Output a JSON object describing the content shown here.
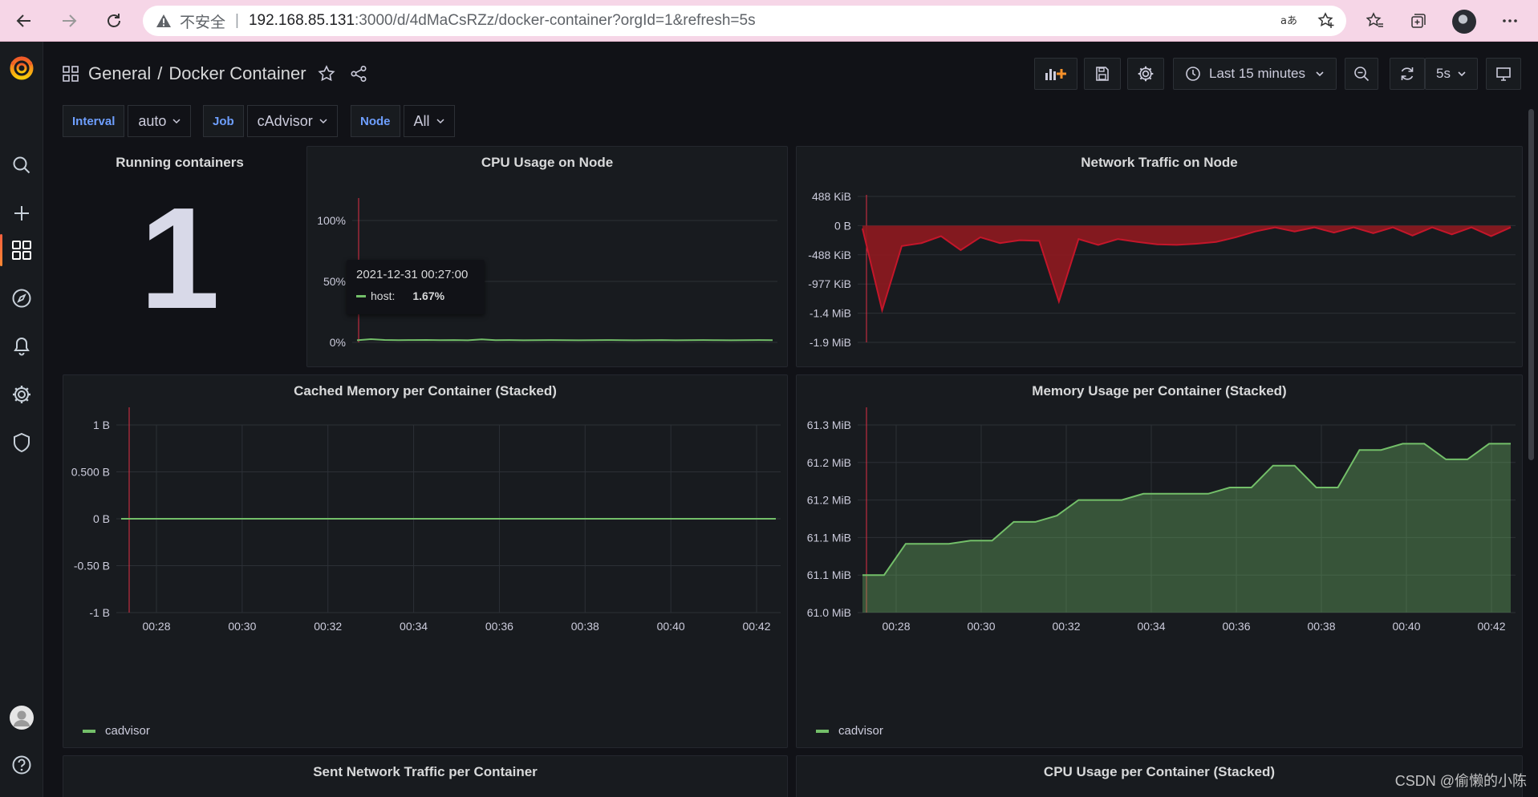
{
  "browser": {
    "insecure_label": "不安全",
    "url_host": "192.168.85.131",
    "url_path": ":3000/d/4dMaCsRZz/docker-container?orgId=1&refresh=5s"
  },
  "header": {
    "folder": "General",
    "separator": "/",
    "title": "Docker Container"
  },
  "toolbar": {
    "time_range": "Last 15 minutes",
    "refresh_interval": "5s"
  },
  "variables": [
    {
      "label": "Interval",
      "value": "auto"
    },
    {
      "label": "Job",
      "value": "cAdvisor"
    },
    {
      "label": "Node",
      "value": "All"
    }
  ],
  "panels": {
    "running": {
      "title": "Running containers",
      "value": "1"
    },
    "cpu_node": {
      "title": "CPU Usage on Node",
      "tooltip": {
        "time": "2021-12-31 00:27:00",
        "series": "host:",
        "value": "1.67%"
      }
    },
    "net_node": {
      "title": "Network Traffic on Node"
    },
    "cached_mem": {
      "title": "Cached Memory per Container (Stacked)",
      "legend": "cadvisor"
    },
    "mem_usage": {
      "title": "Memory Usage per Container (Stacked)",
      "legend": "cadvisor"
    },
    "sent_net": {
      "title": "Sent Network Traffic per Container"
    },
    "cpu_container": {
      "title": "CPU Usage per Container (Stacked)"
    }
  },
  "watermark": "CSDN @偷懒的小陈",
  "colors": {
    "background": "#111217",
    "panel": "#181b1f",
    "series_green": "#73bf69",
    "series_red": "#e02f44",
    "accent_blue": "#6e9fff"
  },
  "chart_data": [
    {
      "type": "line",
      "title": "CPU Usage on Node",
      "y_ticks": [
        "100%",
        "50%",
        "0%"
      ],
      "ylim": [
        0,
        100
      ],
      "series": [
        {
          "name": "host",
          "values": [
            1.7,
            2.6,
            2.0,
            1.8,
            1.9,
            2.0,
            1.8,
            1.9,
            1.7,
            2.5,
            1.8,
            1.9,
            1.7,
            1.8,
            1.9,
            1.8,
            1.7,
            1.8,
            1.9,
            1.8,
            1.7,
            1.8,
            1.9,
            1.7,
            1.8,
            1.9,
            1.8,
            1.7,
            1.8,
            1.9,
            1.8
          ]
        }
      ]
    },
    {
      "type": "area",
      "title": "Network Traffic on Node",
      "y_ticks": [
        "488 KiB",
        "0 B",
        "-488 KiB",
        "-977 KiB",
        "-1.4 MiB",
        "-1.9 MiB"
      ],
      "ylim": [
        -2000,
        500
      ],
      "series": [
        {
          "name": "",
          "values": [
            -50,
            -1450,
            -350,
            -300,
            -180,
            -420,
            -200,
            -300,
            -250,
            -260,
            -1300,
            -230,
            -330,
            -230,
            -280,
            -320,
            -330,
            -310,
            -280,
            -200,
            -100,
            -30,
            -100,
            -30,
            -120,
            -30,
            -130,
            -30,
            -170,
            -30,
            -150,
            -30,
            -180,
            -30
          ]
        }
      ]
    },
    {
      "type": "line",
      "title": "Cached Memory per Container (Stacked)",
      "x_ticks": [
        "00:28",
        "00:30",
        "00:32",
        "00:34",
        "00:36",
        "00:38",
        "00:40",
        "00:42"
      ],
      "y_ticks": [
        "1 B",
        "0.500 B",
        "0 B",
        "-0.50 B",
        "-1 B"
      ],
      "ylim": [
        -1,
        1
      ],
      "series": [
        {
          "name": "cadvisor",
          "values": [
            0,
            0,
            0,
            0,
            0,
            0,
            0,
            0,
            0,
            0,
            0,
            0,
            0,
            0,
            0,
            0
          ]
        }
      ]
    },
    {
      "type": "area",
      "title": "Memory Usage per Container (Stacked)",
      "x_ticks": [
        "00:28",
        "00:30",
        "00:32",
        "00:34",
        "00:36",
        "00:38",
        "00:40",
        "00:42"
      ],
      "y_ticks": [
        "61.3 MiB",
        "61.2 MiB",
        "61.2 MiB",
        "61.1 MiB",
        "61.1 MiB",
        "61.0 MiB"
      ],
      "ylim": [
        61.0,
        61.3
      ],
      "series": [
        {
          "name": "cadvisor",
          "values": [
            61.06,
            61.06,
            61.11,
            61.11,
            61.11,
            61.115,
            61.115,
            61.145,
            61.145,
            61.155,
            61.18,
            61.18,
            61.18,
            61.19,
            61.19,
            61.19,
            61.19,
            61.2,
            61.2,
            61.235,
            61.235,
            61.2,
            61.2,
            61.26,
            61.26,
            61.27,
            61.27,
            61.245,
            61.245,
            61.27,
            61.27
          ]
        }
      ]
    }
  ]
}
